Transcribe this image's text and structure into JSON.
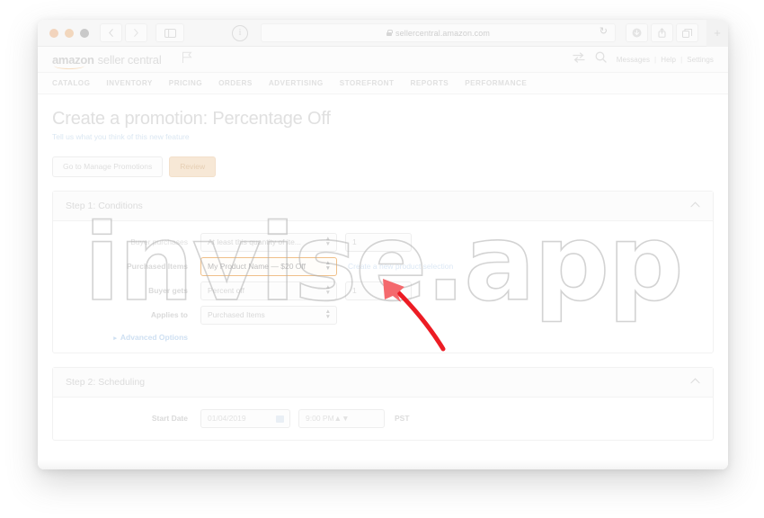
{
  "browser": {
    "url": "sellercentral.amazon.com",
    "lock_icon": "lock-icon",
    "back_icon": "chevron-left-icon",
    "forward_icon": "chevron-right-icon",
    "sidebar_icon": "sidebar-toggle-icon",
    "info_icon": "info-icon",
    "reload_icon": "reload-icon",
    "download_icon": "download-icon",
    "share_icon": "share-icon",
    "tabs_icon": "tabs-icon",
    "new_tab_label": "+"
  },
  "sc_header": {
    "brand_amazon": "amazon",
    "brand_seller_central": "seller central",
    "flag_icon": "flag-icon",
    "switch_icon": "switch-accounts-icon",
    "search_icon": "search-icon",
    "links": [
      "Messages",
      "Help",
      "Settings"
    ],
    "separator": "|"
  },
  "nav": {
    "items": [
      "CATALOG",
      "INVENTORY",
      "PRICING",
      "ORDERS",
      "ADVERTISING",
      "STOREFRONT",
      "REPORTS",
      "PERFORMANCE"
    ]
  },
  "page": {
    "title": "Create a promotion: Percentage Off",
    "subtitle_link": "Tell us what you think of this new feature"
  },
  "toolbar": {
    "manage_promotions_label": "Go to Manage Promotions",
    "review_label": "Review",
    "review_bg": "#f7e8d6"
  },
  "step1": {
    "title": "Step 1: Conditions",
    "collapse_icon": "chevron-up-icon",
    "rows": [
      {
        "label": "Buyer purchases",
        "select_value": "At least this quantity of ite...",
        "input_value": "1"
      },
      {
        "label": "Purchased Items",
        "select_value": "My Product Name — $20 Off",
        "link": "Create a new product selection",
        "highlight_color": "#f0c089"
      },
      {
        "label": "Buyer gets",
        "select_value": "Percent off",
        "input_value": "1"
      },
      {
        "label": "Applies to",
        "select_value": "Purchased Items"
      }
    ],
    "advanced_options": "Advanced Options",
    "advanced_caret": "▸"
  },
  "step2": {
    "title": "Step 2: Scheduling",
    "collapse_icon": "chevron-up-icon",
    "start_date_label": "Start Date",
    "start_date_value": "01/04/2019",
    "start_time_value": "9:00 PM",
    "timezone": "PST",
    "calendar_icon": "calendar-icon"
  },
  "watermark": {
    "text": "invise.app"
  },
  "annotation": {
    "arrow_color": "#ec1c24",
    "arrow_name": "red-pointer-arrow"
  }
}
